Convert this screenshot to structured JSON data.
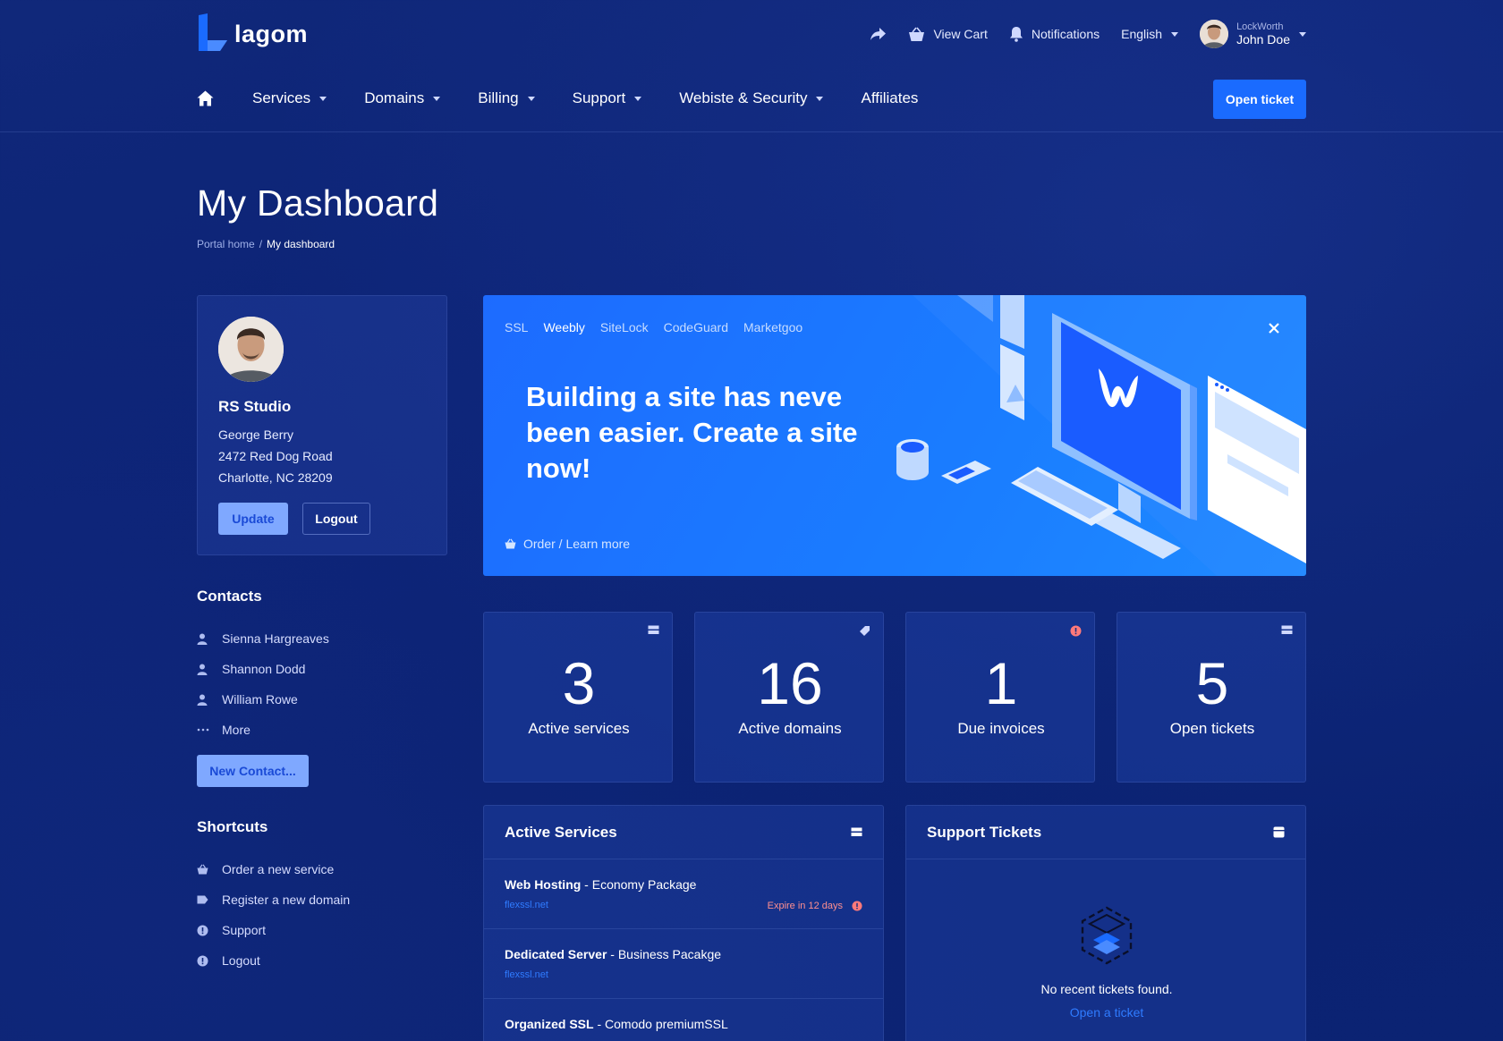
{
  "brand": {
    "name": "lagom"
  },
  "topbar": {
    "view_cart": "View Cart",
    "notifications": "Notifications",
    "language": "English",
    "user_company": "LockWorth",
    "user_name": "John Doe"
  },
  "nav": {
    "items": [
      {
        "label": "Services",
        "dropdown": true
      },
      {
        "label": "Domains",
        "dropdown": true
      },
      {
        "label": "Billing",
        "dropdown": true
      },
      {
        "label": "Support",
        "dropdown": true
      },
      {
        "label": "Webiste & Security",
        "dropdown": true
      },
      {
        "label": "Affiliates",
        "dropdown": false
      }
    ],
    "open_ticket": "Open ticket"
  },
  "page": {
    "title": "My Dashboard",
    "breadcrumb": [
      "Portal home",
      "My dashboard"
    ]
  },
  "profile": {
    "company": "RS Studio",
    "name": "George Berry",
    "address1": "2472 Red Dog Road",
    "address2": "Charlotte, NC 28209",
    "update_label": "Update",
    "logout_label": "Logout"
  },
  "contacts": {
    "heading": "Contacts",
    "items": [
      "Sienna Hargreaves",
      "Shannon Dodd",
      "William Rowe"
    ],
    "more": "More",
    "new_contact": "New Contact..."
  },
  "shortcuts": {
    "heading": "Shortcuts",
    "items": [
      "Order a new service",
      "Register a new domain",
      "Support",
      "Logout"
    ]
  },
  "promo": {
    "tabs": [
      "SSL",
      "Weebly",
      "SiteLock",
      "CodeGuard",
      "Marketgoo"
    ],
    "active_tab": "Weebly",
    "headline": "Building a site has neve been easier. Create a site now!",
    "link": "Order / Learn more"
  },
  "stats": [
    {
      "value": "3",
      "label": "Active services",
      "icon": "server-icon"
    },
    {
      "value": "16",
      "label": "Active domains",
      "icon": "tag-icon"
    },
    {
      "value": "1",
      "label": "Due invoices",
      "icon": "alert-icon"
    },
    {
      "value": "5",
      "label": "Open tickets",
      "icon": "ticket-icon"
    }
  ],
  "active_services": {
    "title": "Active Services",
    "items": [
      {
        "product": "Web Hosting",
        "package": " - Economy Package",
        "domain": "flexssl.net",
        "expire": "Expire in 12 days"
      },
      {
        "product": "Dedicated Server",
        "package": " - Business Pacakge",
        "domain": "flexssl.net"
      },
      {
        "product": "Organized SSL",
        "package": " - Comodo premiumSSL"
      }
    ]
  },
  "support_tickets": {
    "title": "Support Tickets",
    "empty_text": "No recent tickets found.",
    "open_link": "Open a ticket"
  },
  "colors": {
    "accent": "#1a6bff",
    "background": "#0c2376",
    "danger": "#ff6b6b",
    "light_button": "#7fa8ff"
  }
}
